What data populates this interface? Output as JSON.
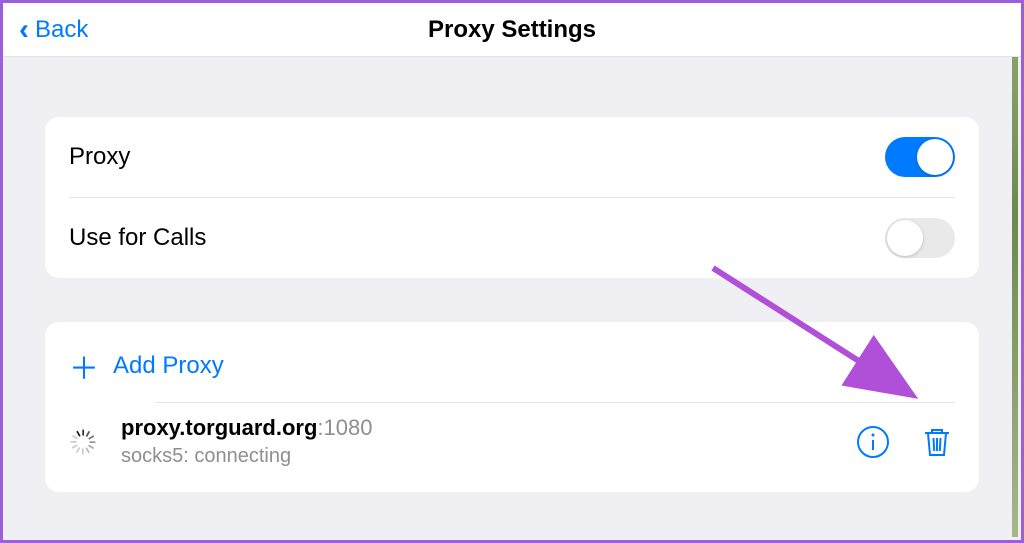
{
  "header": {
    "back_label": "Back",
    "title": "Proxy Settings"
  },
  "colors": {
    "accent": "#007aff",
    "annotation": "#b04fd8"
  },
  "section1": {
    "items": [
      {
        "label": "Proxy",
        "toggle": true
      },
      {
        "label": "Use for Calls",
        "toggle": false
      }
    ]
  },
  "section2": {
    "add_label": "Add Proxy",
    "proxies": [
      {
        "host": "proxy.torguard.org",
        "port": ":1080",
        "status": "socks5: connecting",
        "state": "connecting"
      }
    ]
  }
}
